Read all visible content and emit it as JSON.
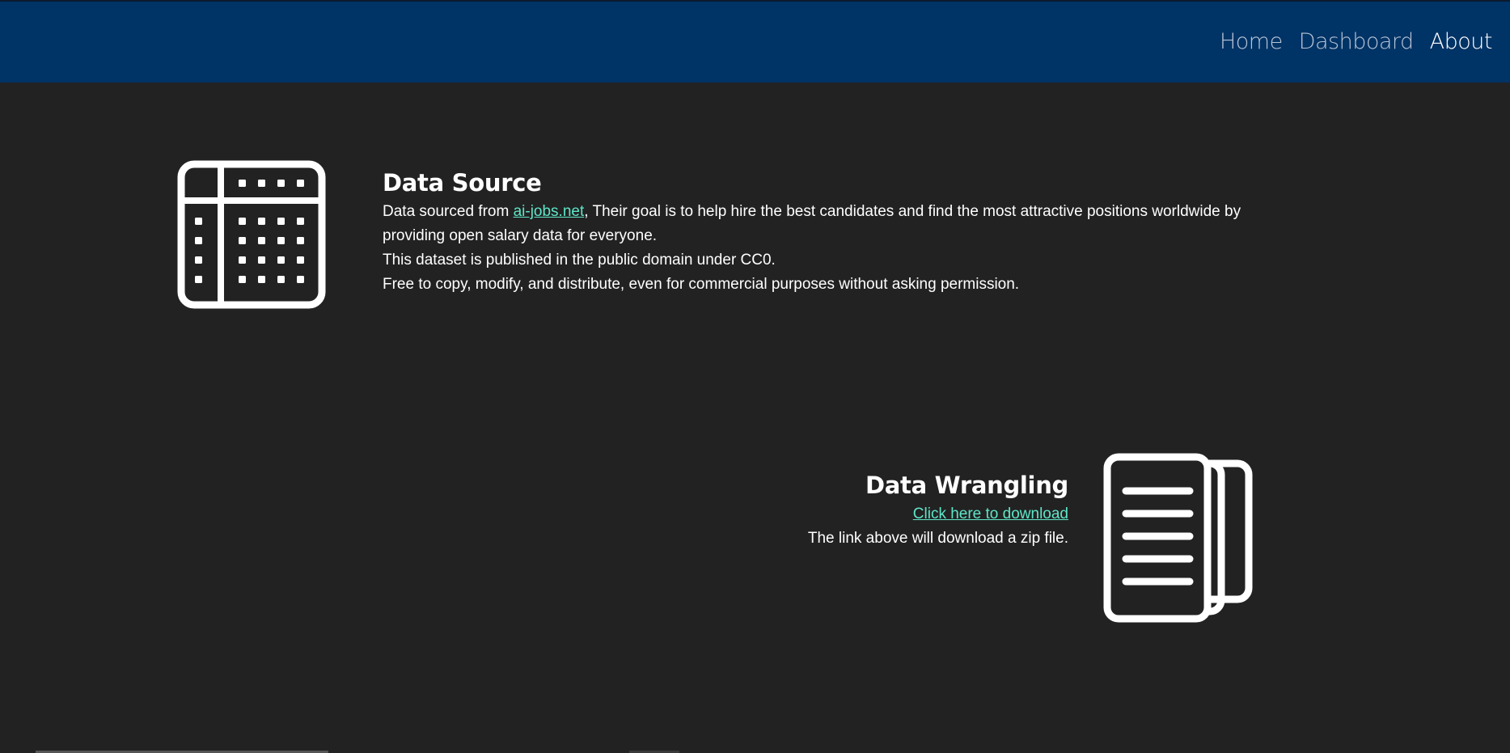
{
  "nav": {
    "items": [
      {
        "label": "Home",
        "active": false
      },
      {
        "label": "Dashboard",
        "active": false
      },
      {
        "label": "About",
        "active": true
      }
    ]
  },
  "data_source": {
    "title": "Data Source",
    "line1_prefix": "Data sourced from ",
    "link_text": "ai-jobs.net",
    "line1_suffix": ", Their goal is to help hire the best candidates and find the most attractive positions worldwide by providing open salary data for everyone.",
    "line2": "This dataset is published in the public domain under CC0.",
    "line3": "Free to copy, modify, and distribute, even for commercial purposes without asking permission.",
    "icon": "table-icon"
  },
  "data_wrangling": {
    "title": "Data Wrangling",
    "link_text": "Click here to download",
    "note": "The link above will download a zip file.",
    "icon": "documents-icon"
  },
  "colors": {
    "navbar": "#003366",
    "background": "#222222",
    "link": "#5ee6c8"
  }
}
